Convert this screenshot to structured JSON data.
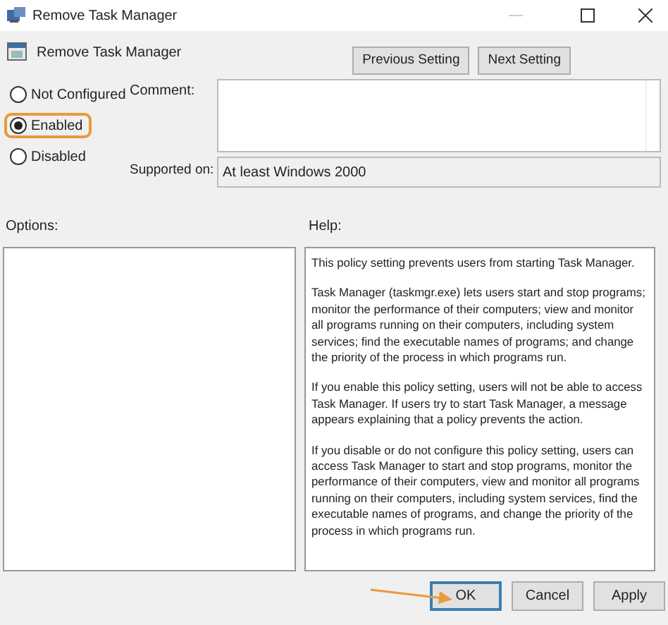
{
  "window": {
    "title": "Remove Task Manager"
  },
  "header": {
    "title": "Remove Task Manager",
    "buttons": [
      "Previous Setting",
      "Next Setting"
    ]
  },
  "options": [
    {
      "label": "Not Configured",
      "selected": false,
      "highlighted": false
    },
    {
      "label": "Enabled",
      "selected": true,
      "highlighted": true
    },
    {
      "label": "Disabled",
      "selected": false,
      "highlighted": false
    }
  ],
  "comment": {
    "label": "Comment:"
  },
  "supported": {
    "label": "Supported on:",
    "value": "At least Windows 2000"
  },
  "options_panel": {
    "label": "Options:"
  },
  "help": {
    "label": "Help:",
    "paragraphs": [
      "This policy setting prevents users from starting Task Manager.",
      "Task Manager (taskmgr.exe) lets users start and stop programs; monitor the performance of their computers; view and monitor all programs running on their computers, including system services; find the executable names of programs; and change the priority of the process in which programs run.",
      "If you enable this policy setting, users will not be able to access Task Manager. If users try to start Task Manager, a message appears explaining that a policy prevents the action.",
      "If you disable or do not configure this policy setting, users can access Task Manager to  start and stop programs, monitor the performance of their computers, view and monitor all programs running on their computers, including system services, find the executable names of programs, and change the priority of the process in which programs run."
    ]
  },
  "buttons": [
    {
      "label": "OK",
      "default": true
    },
    {
      "label": "Cancel",
      "default": false
    },
    {
      "label": "Apply",
      "default": false
    }
  ]
}
